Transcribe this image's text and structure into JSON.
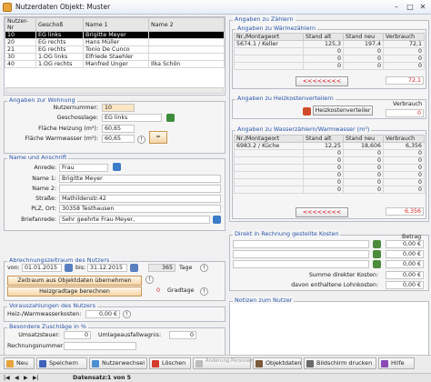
{
  "window": {
    "title": "Nutzerdaten   Objekt: Muster"
  },
  "colors": {
    "accent": "#2a55a8",
    "selection": "#000000",
    "warn": "#d21f1f",
    "button": "#f4d6a8"
  },
  "users_table": {
    "columns": [
      "Nutzer-Nr",
      "Geschoß",
      "Name 1",
      "Name 2"
    ],
    "rows": [
      [
        "10",
        "EG links",
        "Brigitte Meyer",
        ""
      ],
      [
        "20",
        "EG rechts",
        "Hans Müller",
        ""
      ],
      [
        "21",
        "EG rechts",
        "Tonio De Cunco",
        ""
      ],
      [
        "30",
        "1.OG links",
        "Elfriede Staehler",
        ""
      ],
      [
        "40",
        "1.OG rechts",
        "Manfred Unger",
        "Ilka Schön"
      ]
    ]
  },
  "wohnung": {
    "title": "Angaben zur Wohnung",
    "nutzernummer_label": "Nutzernummer:",
    "nutzernummer": "10",
    "geschoss_label": "Geschosslage:",
    "geschoss": "EG links",
    "heizung_label": "Fläche Heizung (m²):",
    "heizung": "60,65",
    "warmwasser_label": "Fläche Warmwasser (m²):",
    "warmwasser": "60,65"
  },
  "anschrift": {
    "title": "Name und Anschrift",
    "anrede_label": "Anrede:",
    "anrede": "Frau",
    "name1_label": "Name 1:",
    "name1": "Brigitte Meyer",
    "name2_label": "Name 2:",
    "name2": "",
    "strasse_label": "Straße:",
    "strasse": "Mathildenstr.42",
    "ort_label": "PLZ, Ort:",
    "ort": "30358 Testhausen",
    "briefanrede_label": "Briefanrede:",
    "briefanrede": "Sehr geehrte Frau Meyer,"
  },
  "zeitraum": {
    "title": "Abrechnungszeitraum des Nutzers",
    "von_label": "von:",
    "von": "01.01.2015",
    "bis_label": "bis:",
    "bis": "31.12.2015",
    "tage": "365",
    "tage_label": "Tage",
    "btn_objekt": "Zeitraum aus Objektdaten übernehmen",
    "btn_heiz": "Heizgradtage berechnen",
    "gradtage": "0",
    "gradtage_label": "Gradtage"
  },
  "voraus": {
    "title": "Vorauszahlungen des Nutzers",
    "label": "Heiz-/Warmwasserkosten:",
    "value": "0,00 €"
  },
  "zuschlaege": {
    "title": "Besondere Zuschläge in %",
    "umsatz_label": "Umsatzsteuer:",
    "umsatz": "0",
    "umlage_label": "Umlageausfallwagnis:",
    "umlage": "0",
    "rechnung_label": "Rechnungsnummer:",
    "rechnung": ""
  },
  "zaehler": {
    "title": "Angaben zu Zählern",
    "warm_title": "Angaben zu Wärmezählern",
    "warm_cols": [
      "Nr./Montageort",
      "Stand alt",
      "Stand neu",
      "Verbrauch"
    ],
    "warm_rows": [
      [
        "5674.1 / Keller",
        "125,3",
        "197,4",
        "72,1"
      ],
      [
        "",
        "0",
        "0",
        "0"
      ],
      [
        "",
        "0",
        "0",
        "0"
      ],
      [
        "",
        "0",
        "0",
        "0"
      ]
    ],
    "warm_sum": "72,1",
    "heizkosten_title": "Angaben zu Heizkostenverteilern",
    "heizkosten_btn": "Heizkostenverteiler",
    "heizkosten_verbrauch_label": "Verbrauch",
    "heizkosten_verbrauch": "0",
    "wasser_title": "Angaben zu Wasserzählern/Warmwasser (m³)",
    "wasser_cols": [
      "Nr./Montageort",
      "Stand alt",
      "Stand neu",
      "Verbrauch"
    ],
    "wasser_rows": [
      [
        "6983.2 / Küche",
        "12,25",
        "18,606",
        "6,356"
      ],
      [
        "",
        "0",
        "0",
        "0"
      ],
      [
        "",
        "0",
        "0",
        "0"
      ],
      [
        "",
        "0",
        "0",
        "0"
      ],
      [
        "",
        "0",
        "0",
        "0"
      ],
      [
        "",
        "0",
        "0",
        "0"
      ],
      [
        "",
        "0",
        "0",
        "0"
      ]
    ],
    "wasser_sum": "6,356",
    "arrows": "<<<<<<<<"
  },
  "direkt": {
    "title": "Direkt in Rechnung gestellte Kosten",
    "betrag_label": "Betrag",
    "rows": [
      "0,00 €",
      "0,00 €",
      "0,00 €"
    ],
    "summe_label": "Summe direkter Kosten:",
    "summe": "0,00 €",
    "lohn_label": "davon enthaltene Lohnkosten:",
    "lohn": "0,00 €"
  },
  "notizen": {
    "title": "Notizen zum Nutzer"
  },
  "toolbar": {
    "neu": "Neu",
    "speichern": "Speichern",
    "nutzerwechsel": "Nutzerwechsel",
    "loeschen": "Löschen",
    "aenderung": "Änderung Personenzahl",
    "objektdaten": "Objektdaten",
    "bildschirm": "Bildschirm drucken",
    "hilfe": "Hilfe"
  },
  "statusbar": {
    "label": "Datensatz:",
    "value": "1 von 5"
  }
}
